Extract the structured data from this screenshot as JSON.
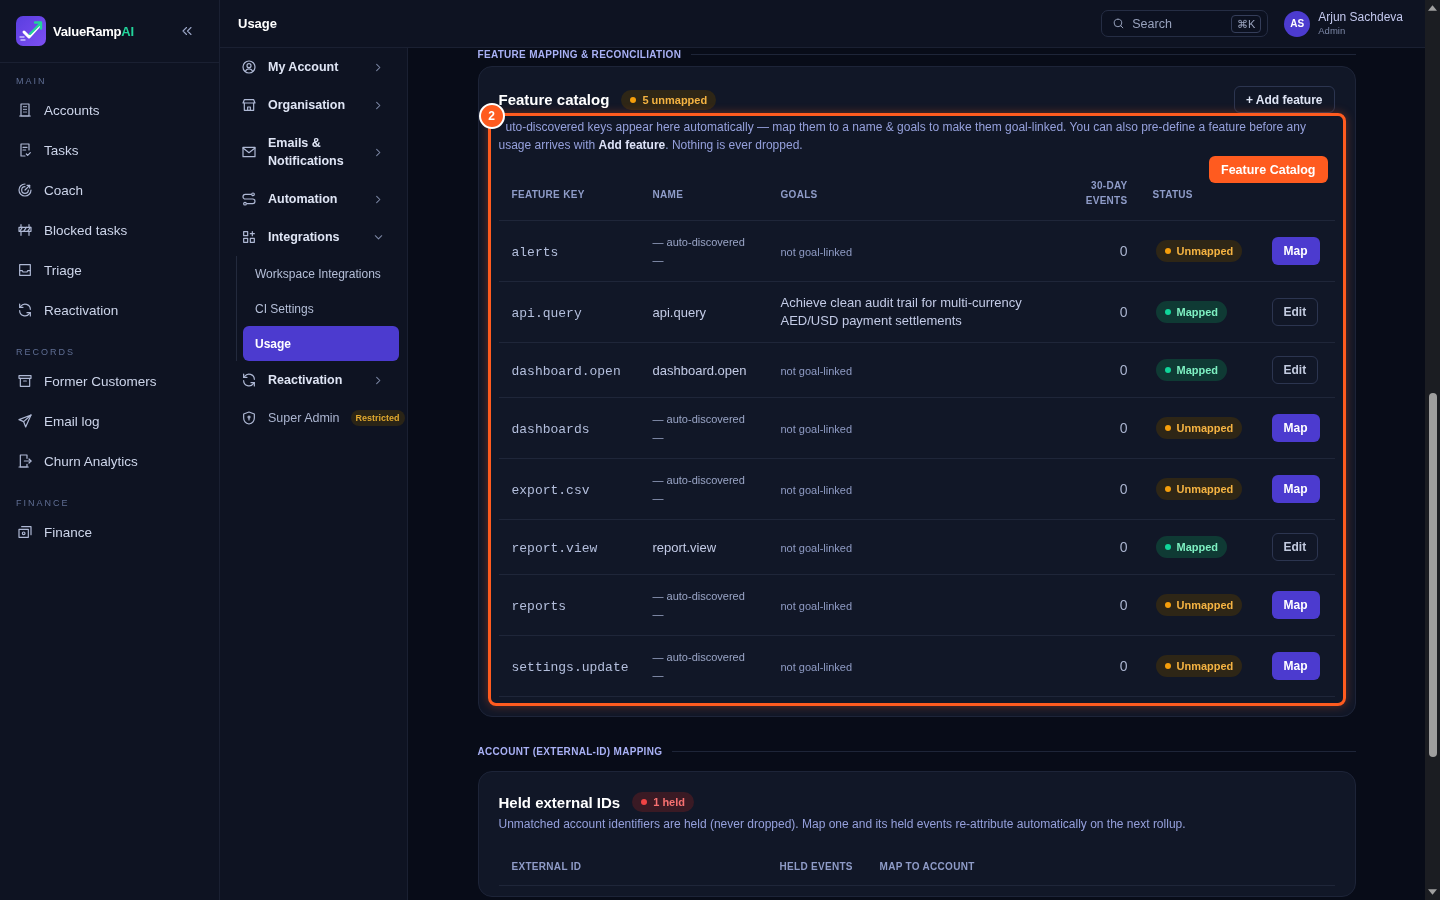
{
  "topbar": {
    "title": "Usage",
    "search": {
      "placeholder": "Search",
      "shortcut": "⌘K"
    },
    "user": {
      "initials": "AS",
      "name": "Arjun Sachdeva",
      "role": "Admin"
    }
  },
  "sidebar": {
    "brand": {
      "name": "ValueRamp",
      "accent": "AI"
    },
    "sections": [
      {
        "title": "MAIN",
        "items": [
          {
            "label": "Accounts",
            "selected": false
          },
          {
            "label": "Tasks",
            "selected": false
          },
          {
            "label": "Coach",
            "selected": false
          },
          {
            "label": "Blocked tasks",
            "selected": false
          },
          {
            "label": "Triage",
            "selected": false
          },
          {
            "label": "Reactivation",
            "selected": false
          }
        ]
      },
      {
        "title": "RECORDS",
        "items": [
          {
            "label": "Former Customers",
            "selected": false
          },
          {
            "label": "Email log",
            "selected": false
          },
          {
            "label": "Churn Analytics",
            "selected": false
          }
        ]
      },
      {
        "title": "FINANCE",
        "items": [
          {
            "label": "Finance",
            "selected": false
          }
        ]
      }
    ]
  },
  "settings_nav": {
    "items": [
      {
        "label": "My Account",
        "kind": "group",
        "expanded": false
      },
      {
        "label": "Organisation",
        "kind": "group",
        "expanded": false
      },
      {
        "label": "Emails & Notifications",
        "kind": "group",
        "expanded": false
      },
      {
        "label": "Automation",
        "kind": "group",
        "expanded": false
      },
      {
        "label": "Integrations",
        "kind": "group",
        "expanded": true,
        "children": [
          {
            "label": "Workspace Integrations",
            "selected": false
          },
          {
            "label": "CI Settings",
            "selected": false
          },
          {
            "label": "Usage",
            "selected": true
          }
        ]
      },
      {
        "label": "Reactivation",
        "kind": "group",
        "expanded": false
      },
      {
        "label": "Super Admin",
        "kind": "restricted",
        "badge": "Restricted"
      }
    ]
  },
  "sections": [
    {
      "heading": "FEATURE MAPPING & RECONCILIATION",
      "card": {
        "title": "Feature catalog",
        "badge": {
          "label": "5 unmapped",
          "kind": "warning"
        },
        "button": "+ Add feature",
        "highlight": {
          "step": "2",
          "label": "Feature Catalog"
        },
        "description": "uto-discovered keys appear here automatically — map them to a name & goals to make them goal-linked. You can also pre-define a feature before any usage arrives with **Add feature**. Nothing is ever dropped.",
        "table": {
          "kind": "catalog",
          "columns": [
            "FEATURE KEY",
            "NAME",
            "GOALS",
            "30-DAY EVENTS",
            "STATUS"
          ],
          "rows": [
            {
              "key": "alerts",
              "name": "— auto-discovered —",
              "goals": "not goal-linked",
              "goal_linked": false,
              "events": "0",
              "status": "Unmapped",
              "kind": "unmapped",
              "action": "Map"
            },
            {
              "key": "api.query",
              "name": "api.query",
              "goals": "Achieve clean audit trail for multi-currency AED/USD payment settlements",
              "goal_linked": true,
              "events": "0",
              "status": "Mapped",
              "kind": "mapped",
              "action": "Edit"
            },
            {
              "key": "dashboard.open",
              "name": "dashboard.open",
              "goals": "not goal-linked",
              "goal_linked": false,
              "events": "0",
              "status": "Mapped",
              "kind": "mapped",
              "action": "Edit"
            },
            {
              "key": "dashboards",
              "name": "— auto-discovered —",
              "goals": "not goal-linked",
              "goal_linked": false,
              "events": "0",
              "status": "Unmapped",
              "kind": "unmapped",
              "action": "Map"
            },
            {
              "key": "export.csv",
              "name": "— auto-discovered —",
              "goals": "not goal-linked",
              "goal_linked": false,
              "events": "0",
              "status": "Unmapped",
              "kind": "unmapped",
              "action": "Map"
            },
            {
              "key": "report.view",
              "name": "report.view",
              "goals": "not goal-linked",
              "goal_linked": false,
              "events": "0",
              "status": "Mapped",
              "kind": "mapped",
              "action": "Edit"
            },
            {
              "key": "reports",
              "name": "— auto-discovered —",
              "goals": "not goal-linked",
              "goal_linked": false,
              "events": "0",
              "status": "Unmapped",
              "kind": "unmapped",
              "action": "Map"
            },
            {
              "key": "settings.update",
              "name": "— auto-discovered —",
              "goals": "not goal-linked",
              "goal_linked": false,
              "events": "0",
              "status": "Unmapped",
              "kind": "unmapped",
              "action": "Map"
            }
          ]
        }
      }
    },
    {
      "heading": "ACCOUNT (EXTERNAL-ID) MAPPING",
      "card": {
        "title": "Held external IDs",
        "badge": {
          "label": "1 held",
          "kind": "danger"
        },
        "description": "Unmatched account identifiers are held (never dropped). Map one and its held events re-attribute automatically on the next rollup.",
        "table": {
          "kind": "held",
          "columns": [
            "EXTERNAL ID",
            "HELD EVENTS",
            "MAP TO ACCOUNT"
          ]
        }
      }
    }
  ]
}
